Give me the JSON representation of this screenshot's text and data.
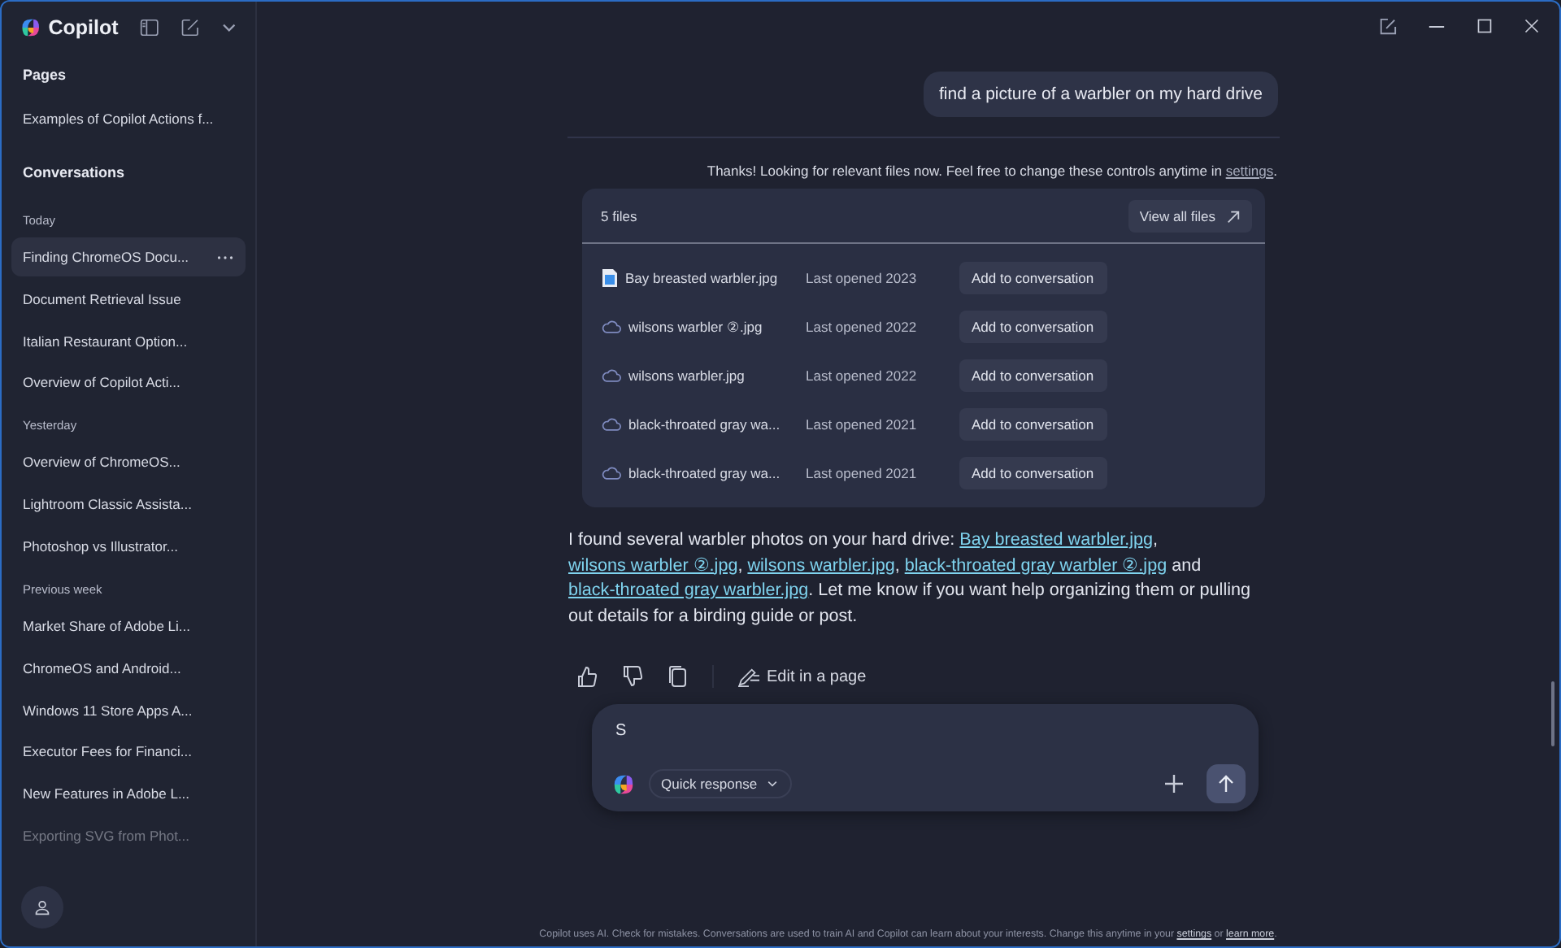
{
  "app": {
    "name": "Copilot"
  },
  "sidebar": {
    "sections": [
      {
        "heading": "Pages",
        "groups": [
          {
            "items": [
              {
                "label": "Examples of Copilot Actions f...",
                "selected": false,
                "faded": false
              }
            ]
          }
        ]
      },
      {
        "heading": "Conversations",
        "groups": [
          {
            "label": "Today",
            "items": [
              {
                "label": "Finding ChromeOS Docu...",
                "selected": true,
                "faded": false
              },
              {
                "label": "Document Retrieval Issue",
                "selected": false,
                "faded": false
              },
              {
                "label": "Italian Restaurant Option...",
                "selected": false,
                "faded": false
              },
              {
                "label": "Overview of Copilot Acti...",
                "selected": false,
                "faded": false
              }
            ]
          },
          {
            "label": "Yesterday",
            "items": [
              {
                "label": "Overview of ChromeOS...",
                "selected": false,
                "faded": false
              },
              {
                "label": "Lightroom Classic Assista...",
                "selected": false,
                "faded": false
              },
              {
                "label": "Photoshop vs Illustrator...",
                "selected": false,
                "faded": false
              }
            ]
          },
          {
            "label": "Previous week",
            "items": [
              {
                "label": "Market Share of Adobe Li...",
                "selected": false,
                "faded": false
              },
              {
                "label": "ChromeOS and Android...",
                "selected": false,
                "faded": false
              },
              {
                "label": "Windows 11 Store Apps A...",
                "selected": false,
                "faded": false
              },
              {
                "label": "Executor Fees for Financi...",
                "selected": false,
                "faded": false
              },
              {
                "label": "New Features in Adobe L...",
                "selected": false,
                "faded": false
              },
              {
                "label": "Exporting SVG from Phot...",
                "selected": false,
                "faded": true
              }
            ]
          }
        ]
      }
    ]
  },
  "chat": {
    "user_message": "find a picture of a warbler on my hard drive",
    "status": [
      {
        "text": "Thanks! Looking for relevant files now. Feel free to change these controls anytime in ",
        "kind": "text"
      },
      {
        "text": "settings",
        "kind": "link"
      },
      {
        "text": ".",
        "kind": "text"
      }
    ],
    "files_card": {
      "count": "5 files",
      "view_all": "View all files",
      "files": [
        {
          "kind": "image",
          "name": "Bay breasted warbler.jpg",
          "opened": "Last opened 2023",
          "action": "Add to conversation"
        },
        {
          "kind": "cloud",
          "name": "wilsons warbler ②.jpg",
          "opened": "Last opened 2022",
          "action": "Add to conversation"
        },
        {
          "kind": "cloud",
          "name": "wilsons warbler.jpg",
          "opened": "Last opened 2022",
          "action": "Add to conversation"
        },
        {
          "kind": "cloud",
          "name": "black-throated gray wa...",
          "opened": "Last opened 2021",
          "action": "Add to conversation"
        },
        {
          "kind": "cloud",
          "name": "black-throated gray wa...",
          "opened": "Last opened 2021",
          "action": "Add to conversation"
        }
      ]
    },
    "answer": [
      {
        "text": "I found several warbler photos on your hard drive: ",
        "kind": "text"
      },
      {
        "text": "Bay breasted warbler.jpg",
        "kind": "link"
      },
      {
        "text": ", ",
        "kind": "text"
      },
      {
        "text": "wilsons warbler ②.jpg",
        "kind": "link"
      },
      {
        "text": ", ",
        "kind": "text"
      },
      {
        "text": "wilsons warbler.jpg",
        "kind": "link"
      },
      {
        "text": ", ",
        "kind": "text"
      },
      {
        "text": "black-throated gray warbler ②.jpg",
        "kind": "link"
      },
      {
        "text": " and ",
        "kind": "text"
      },
      {
        "text": "black-throated gray warbler.jpg",
        "kind": "link"
      },
      {
        "text": ". Let me know if you want help organizing them or pulling out details for a birding guide or post.",
        "kind": "text"
      }
    ],
    "edit_in_page": "Edit in a page",
    "composer": {
      "value": "S",
      "mode": "Quick response"
    },
    "footer": [
      {
        "text": "Copilot uses AI. Check for mistakes. Conversations are used to train AI and Copilot can learn about your interests. Change this anytime in your ",
        "kind": "text"
      },
      {
        "text": "settings",
        "kind": "link"
      },
      {
        "text": " or ",
        "kind": "text"
      },
      {
        "text": "learn more",
        "kind": "link"
      },
      {
        "text": ".",
        "kind": "text"
      }
    ]
  }
}
